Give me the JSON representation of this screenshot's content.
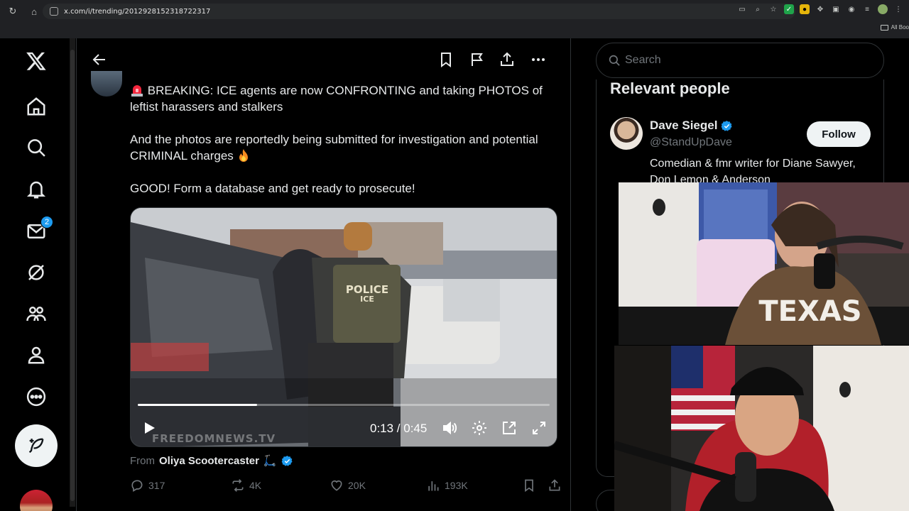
{
  "browser": {
    "url": "x.com/i/trending/2012928152318722317",
    "bookmarks_label": "All Boo"
  },
  "nav": {
    "messages_badge": "2"
  },
  "tweet": {
    "text": "BREAKING: ICE agents are now CONFRONTING and taking PHOTOS of leftist harassers and stalkers\n\nAnd the photos are reportedly being submitted for investigation and potential CRIMINAL charges",
    "text_line3": "GOOD! Form a database and get ready to prosecute!",
    "video": {
      "time": "0:13 / 0:45",
      "progress": 0.289,
      "watermark": "FREEDOMNEWS.TV",
      "vest_text_1": "POLICE",
      "vest_text_2": "ICE"
    },
    "from_prefix": "From",
    "from_name": "Oliya Scootercaster",
    "from_emoji": "🛴",
    "replies": "317",
    "reposts": "4K",
    "likes": "20K",
    "views": "193K"
  },
  "sidebar": {
    "search_placeholder": "Search",
    "relevant_title": "Relevant people",
    "person": {
      "name": "Dave Siegel",
      "handle": "@StandUpDave",
      "bio": "Comedian & fmr writer for Diane Sawyer, Don Lemon & Anderson",
      "follow_label": "Follow"
    }
  },
  "webcam": {
    "shirt_text": "TEXAS"
  },
  "colors": {
    "accent": "#1d9bf0",
    "background": "#000000",
    "text": "#e7e9ea",
    "muted": "#71767b"
  }
}
